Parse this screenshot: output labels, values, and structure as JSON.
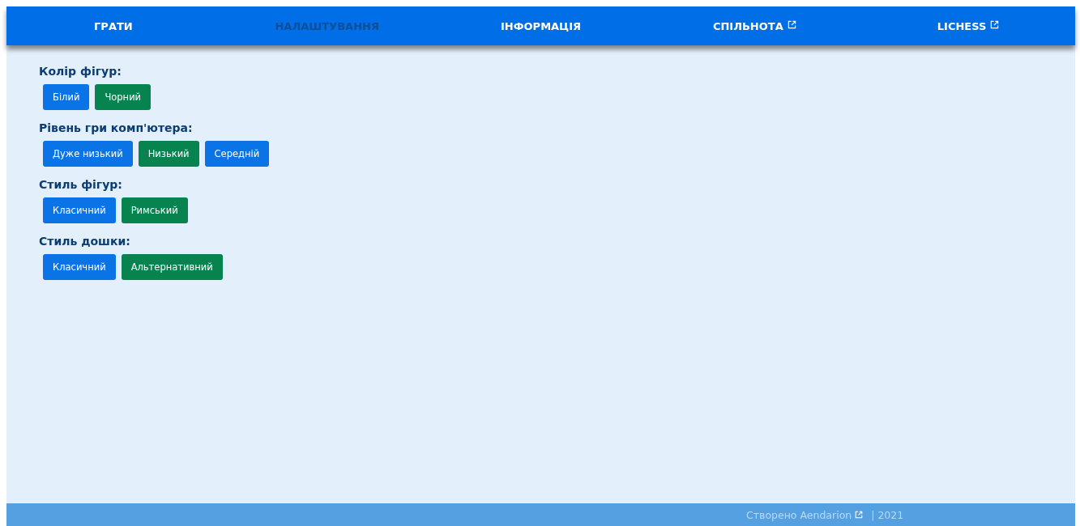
{
  "nav": [
    {
      "label": "ГРАТИ",
      "selected": false,
      "external": false
    },
    {
      "label": "НАЛАШТУВАННЯ",
      "selected": true,
      "external": false
    },
    {
      "label": "ІНФОРМАЦІЯ",
      "selected": false,
      "external": false
    },
    {
      "label": "СПІЛЬНОТА",
      "selected": false,
      "external": true
    },
    {
      "label": "LICHESS",
      "selected": false,
      "external": true
    }
  ],
  "settings": [
    {
      "title": "Колір фігур:",
      "options": [
        {
          "label": "Білий",
          "selected": false
        },
        {
          "label": "Чорний",
          "selected": true
        }
      ]
    },
    {
      "title": "Рівень гри комп'ютера:",
      "options": [
        {
          "label": "Дуже низький",
          "selected": false
        },
        {
          "label": "Низький",
          "selected": true
        },
        {
          "label": "Середній",
          "selected": false
        }
      ]
    },
    {
      "title": "Стиль фігур:",
      "options": [
        {
          "label": "Класичний",
          "selected": false
        },
        {
          "label": "Римський",
          "selected": true
        }
      ]
    },
    {
      "title": "Стиль дошки:",
      "options": [
        {
          "label": "Класичний",
          "selected": false
        },
        {
          "label": "Альтернативний",
          "selected": true
        }
      ]
    }
  ],
  "footer": {
    "prefix": "Створено",
    "author": "Aendarion",
    "suffix": "| 2021"
  }
}
